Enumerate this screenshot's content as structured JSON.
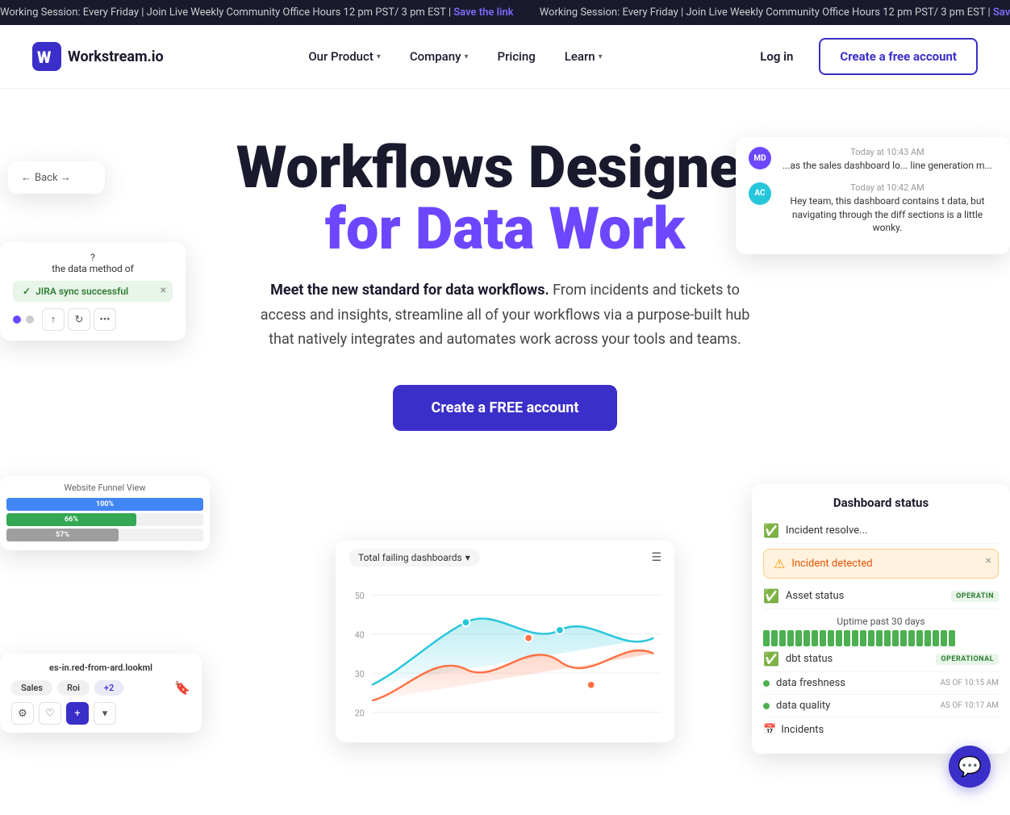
{
  "announcement": {
    "text1": "Working Session: Every Friday | Join Live Weekly Community Office Hours 12 pm PST/ 3 pm EST |",
    "link": "Save the link",
    "text2": "Working Session: Every Friday | Join Live Weekly Community Office Hours 12 pm PS"
  },
  "nav": {
    "logo_text": "Workstream.io",
    "links": [
      {
        "label": "Our Product",
        "has_dropdown": true
      },
      {
        "label": "Company",
        "has_dropdown": true
      },
      {
        "label": "Pricing",
        "has_dropdown": false
      },
      {
        "label": "Learn",
        "has_dropdown": true
      }
    ],
    "login_label": "Log in",
    "cta_label": "Create a free account"
  },
  "hero": {
    "title_line1": "Workflows Designed",
    "title_line2": "for Data Work",
    "subtitle_bold": "Meet the new standard for data workflows.",
    "subtitle_rest": " From incidents and tickets to access and insights, streamline all of your workflows via a purpose-built hub that natively integrates and automates work across your tools and teams.",
    "cta_label": "Create a FREE account"
  },
  "float_back": {
    "label": "Back →"
  },
  "float_jira": {
    "description": "the data method of",
    "badge": "JIRA sync successful",
    "close": "×"
  },
  "float_chat": {
    "msg1": {
      "avatar": "MD",
      "time": "Today at 10:43 AM",
      "text": "...as the sales dashboard lo... line generation m..."
    },
    "msg2": {
      "avatar": "AC",
      "time": "Today at 10:42 AM",
      "text": "Hey team, this dashboard contains t data, but navigating through the diff sections is a little wonky."
    }
  },
  "float_dashboard": {
    "header": "Website Funnel View",
    "bars": [
      {
        "label": "",
        "pct": 100,
        "color": "blue",
        "value": "100%"
      },
      {
        "label": "",
        "pct": 66,
        "color": "green",
        "value": "66%"
      },
      {
        "label": "",
        "pct": 57,
        "color": "gray",
        "value": "57%"
      }
    ]
  },
  "float_lookml": {
    "path": "es-in.red-from-ard.lookml",
    "tags": [
      "Sales",
      "Roi",
      "+2"
    ]
  },
  "float_chart": {
    "dropdown": "Total failing dashboards",
    "y_labels": [
      "50",
      "40",
      "30",
      "20"
    ]
  },
  "float_status": {
    "title": "Dashboard status",
    "items": [
      {
        "icon": "ok",
        "label": "Incident resolve...",
        "badge": ""
      },
      {
        "icon": "warn",
        "label": "Incident detected",
        "badge": "",
        "is_alert": true
      },
      {
        "icon": "ok",
        "label": "Asset status",
        "badge": "OPERATIN"
      },
      {
        "label": "Uptime past 30 days"
      },
      {
        "icon": "ok",
        "label": "dbt status",
        "badge": "OPERATIONAL"
      },
      {
        "label": "data freshness",
        "badge_time": "AS OF 10:15 AM"
      },
      {
        "label": "data quality",
        "badge_time": "AS OF 10:17 AM"
      },
      {
        "icon": "calendar",
        "label": "Incidents"
      }
    ]
  },
  "chat_bubble": {
    "icon": "💬"
  }
}
